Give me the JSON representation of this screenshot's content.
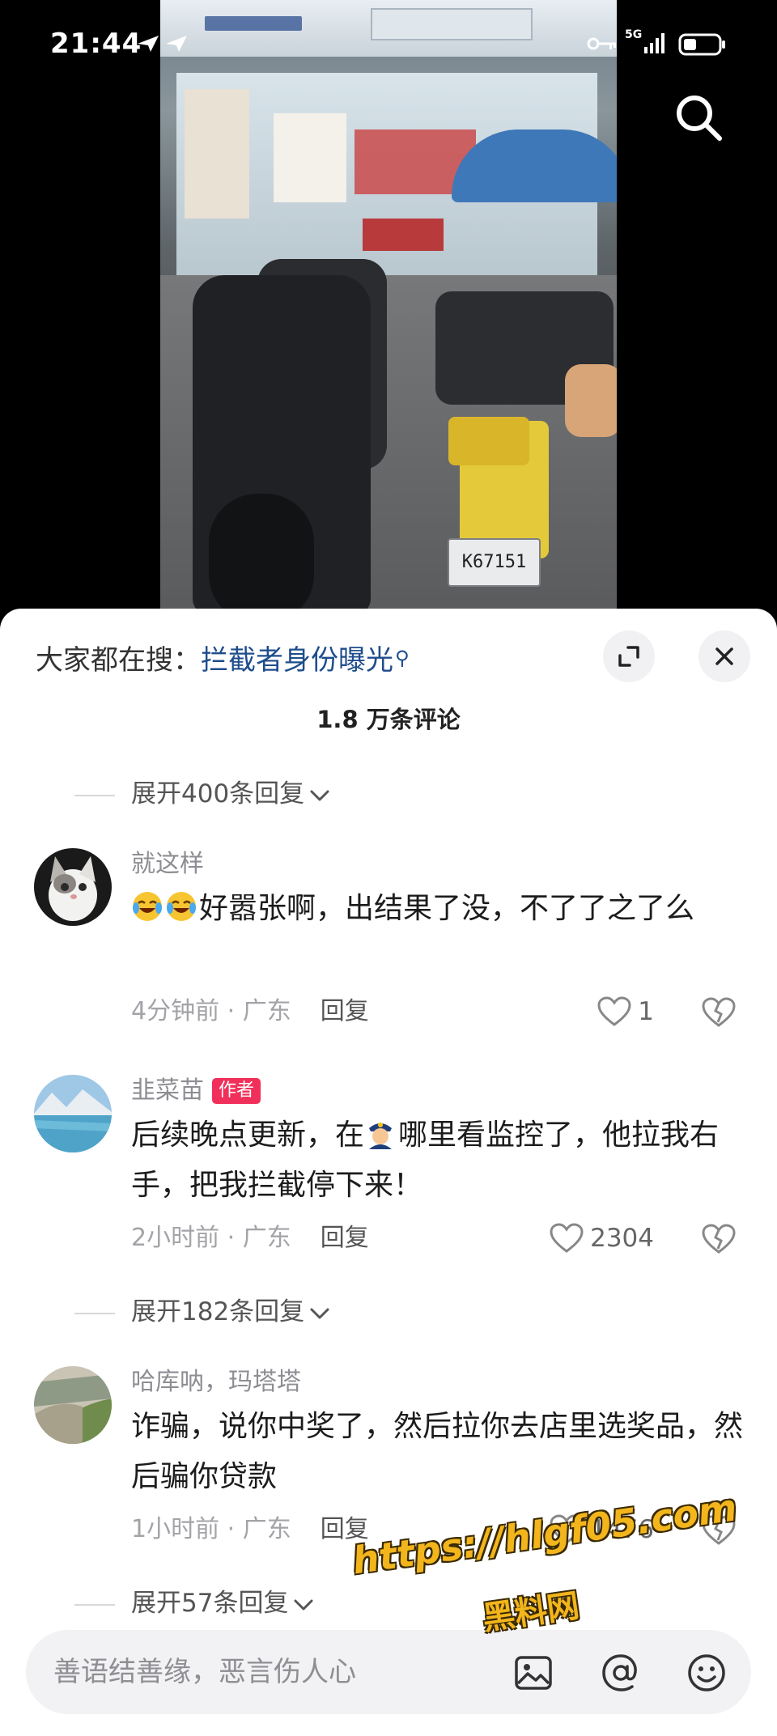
{
  "status_bar": {
    "time": "21:44",
    "network": "5G"
  },
  "video": {
    "plate_text": "K67151"
  },
  "sheet": {
    "hot_search_prefix": "大家都在搜：",
    "hot_search_link": "拦截者身份曝光",
    "title": "1.8 万条评论"
  },
  "replies_top": "展开400条回复",
  "comments": [
    {
      "name": "就这样",
      "text": "好嚣张啊，出结果了没，不了了之了么",
      "time": "4分钟前 · 广东",
      "reply": "回复",
      "likes": "1"
    },
    {
      "name": "韭菜苗",
      "author_tag": "作者",
      "text_before": "后续晚点更新，在",
      "text_after": "哪里看监控了，他拉我右手，把我拦截停下来！",
      "time": "2小时前 · 广东",
      "reply": "回复",
      "likes": "2304",
      "replies": "展开182条回复"
    },
    {
      "name": "哈库呐，玛塔塔",
      "text": "诈骗，说你中奖了，然后拉你去店里选奖品，然后骗你贷款",
      "time": "1小时前 · 广东",
      "reply": "回复",
      "likes": "1476",
      "replies": "展开57条回复"
    }
  ],
  "input": {
    "placeholder": "善语结善缘，恶言伤人心"
  },
  "watermark": {
    "url": "https://hlgf05.com",
    "label": "黑料网"
  },
  "colors": {
    "link": "#1e4d8c",
    "author_tag": "#f0305a",
    "watermark": "#f2b51c"
  }
}
